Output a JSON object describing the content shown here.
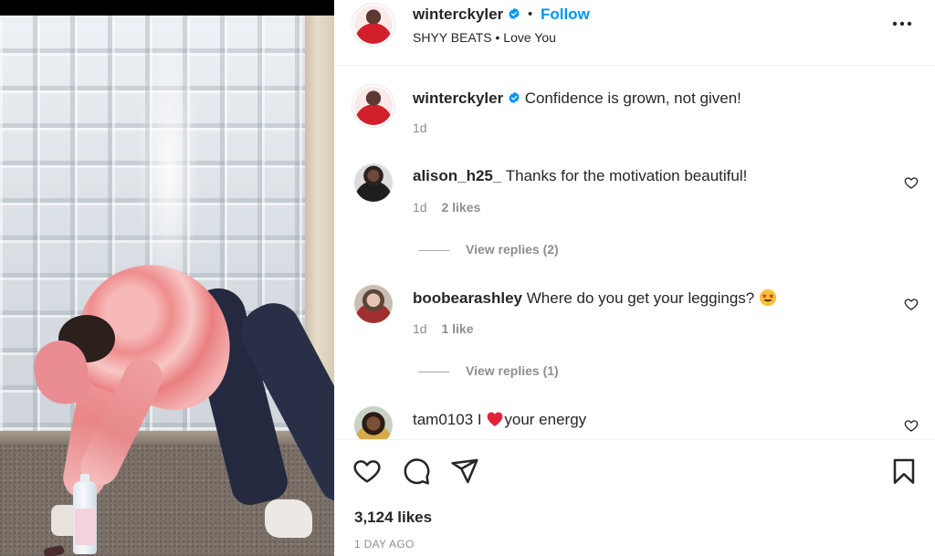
{
  "post": {
    "username": "winterckyler",
    "follow_label": "Follow",
    "separator": "•",
    "audio": "SHYY BEATS • Love You"
  },
  "caption": {
    "username": "winterckyler",
    "text": "Confidence is grown, not given!",
    "time": "1d"
  },
  "comments": [
    {
      "username": "alison_h25_",
      "text": "Thanks for the motivation beautiful!",
      "time": "1d",
      "likes": "2 likes",
      "replies": "View replies (2)"
    },
    {
      "username": "boobearashley",
      "text": "Where do you get your leggings?",
      "emoji": "star-struck-emoji",
      "time": "1d",
      "likes": "1 like",
      "replies": "View replies (1)"
    },
    {
      "username": "tam0103",
      "text_prefix": "I",
      "text_suffix": "your energy",
      "emoji": "red-heart-emoji"
    }
  ],
  "footer": {
    "likes": "3,124 likes",
    "time_ago": "1 DAY AGO"
  },
  "colors": {
    "link_blue": "#0095f6",
    "verified_blue": "#0095f6",
    "text": "#262626",
    "muted": "#8e8e8e"
  },
  "icons": [
    "verified-badge-icon",
    "more-options-icon",
    "heart-icon",
    "comment-icon",
    "share-icon",
    "bookmark-icon"
  ]
}
